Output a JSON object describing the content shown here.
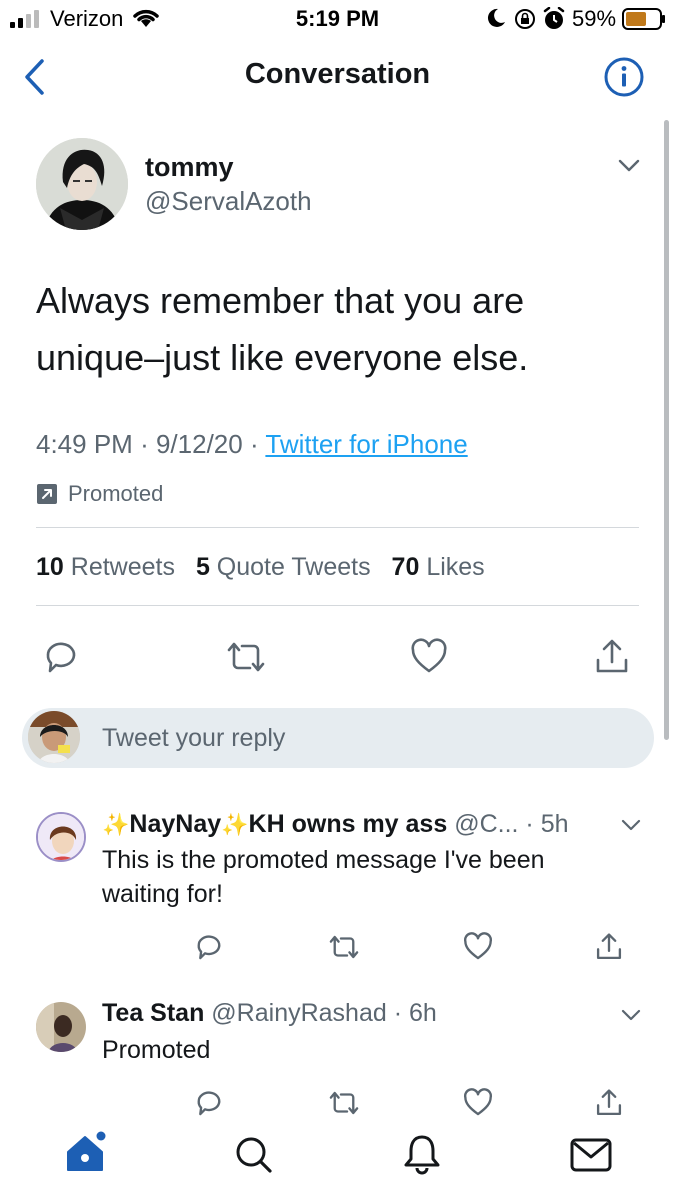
{
  "status_bar": {
    "carrier": "Verizon",
    "time": "5:19 PM",
    "battery_pct": "59%",
    "icons": [
      "signal-icon",
      "wifi-icon",
      "moon-icon",
      "rotation-lock-icon",
      "alarm-icon",
      "battery-icon"
    ]
  },
  "nav": {
    "title": "Conversation",
    "back_icon": "chevron-left-icon",
    "info_icon": "info-icon"
  },
  "tweet": {
    "display_name": "tommy",
    "handle": "@ServalAzoth",
    "line1": "Always remember that you are",
    "line2": "unique–just like everyone else.",
    "time": "4:49 PM",
    "date": "9/12/20",
    "dot": "·",
    "source": "Twitter for iPhone",
    "promoted": "Promoted",
    "stats": {
      "retweets_count": "10",
      "retweets_label": "Retweets",
      "quotes_count": "5",
      "quotes_label": "Quote Tweets",
      "likes_count": "70",
      "likes_label": "Likes"
    }
  },
  "composer": {
    "placeholder": "Tweet your reply"
  },
  "replies": [
    {
      "sparkle": "✨",
      "name_a": "NayNay",
      "name_b": "KH owns my ass",
      "handle": "@C...",
      "time": "· 5h",
      "line1": "This is the promoted message I've been",
      "line2": "waiting for!"
    },
    {
      "name": "Tea Stan",
      "handle": "@RainyRashad",
      "time": "· 6h",
      "text": "Promoted"
    }
  ],
  "tabs": [
    "home-icon",
    "search-icon",
    "notifications-icon",
    "messages-icon"
  ],
  "colors": {
    "accent": "#1da1f2",
    "tab_active": "#1d5fb4",
    "secondary_text": "#5b6670",
    "divider": "#d4d8dc",
    "composer_bg": "#e6ecf0"
  }
}
